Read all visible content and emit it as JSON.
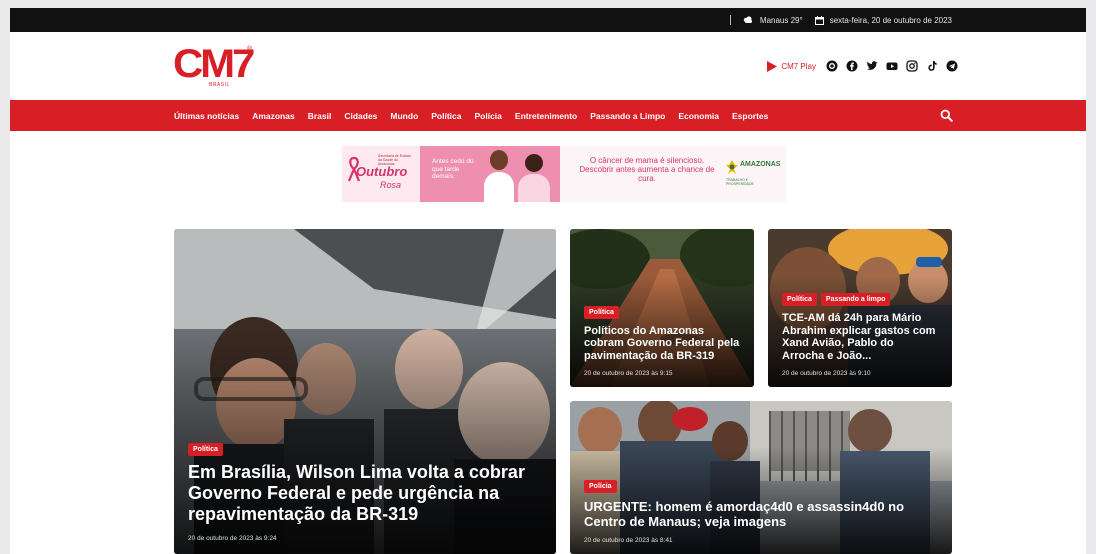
{
  "topbar": {
    "weather": "Manaus 29°",
    "date": "sexta-feira, 20 de outubro de 2023"
  },
  "header": {
    "logo_text": "CM7",
    "logo_reg": "®",
    "logo_sub": "BRASIL",
    "play_label": "CM7 Play",
    "social_icons": [
      "threads-icon",
      "facebook-icon",
      "twitter-icon",
      "youtube-icon",
      "instagram-icon",
      "tiktok-icon",
      "telegram-icon"
    ]
  },
  "nav": {
    "items": [
      "Últimas notícias",
      "Amazonas",
      "Brasil",
      "Cidades",
      "Mundo",
      "Política",
      "Polícia",
      "Entretenimento",
      "Passando a Limpo",
      "Economia",
      "Esportes"
    ]
  },
  "banner": {
    "outubro": "Outubro",
    "rosa": "Rosa",
    "small": "Secretaria de Estado da Saúde do Amazonas",
    "tagline": "Antes cedo do que tarde demais.",
    "message": "O câncer de mama é silencioso. Descobrir antes aumenta a chance de cura.",
    "gov_name": "AMAZONAS",
    "gov_sub": "TRABALHO E PROSPERIDADE"
  },
  "cards": {
    "main": {
      "badges": [
        "Política"
      ],
      "title": "Em Brasília, Wilson Lima volta a cobrar Governo Federal e pede urgência na repavimentação da BR-319",
      "date": "20 de outubro de 2023 às 9:24"
    },
    "road": {
      "badges": [
        "Política"
      ],
      "title": "Políticos do Amazonas cobram Governo Federal pela pavimentação da BR-319",
      "date": "20 de outubro de 2023 às 9:15"
    },
    "tce": {
      "badges": [
        "Política",
        "Passando a limpo"
      ],
      "title": "TCE-AM dá 24h para Mário Abrahim explicar gastos com Xand Avião, Pablo do Arrocha e João...",
      "date": "20 de outubro de 2023 às 9:10"
    },
    "urgent": {
      "badges": [
        "Polícia"
      ],
      "title": "URGENTE: homem é amordaç4d0 e assassin4d0 no Centro de Manaus; veja imagens",
      "date": "20 de outubro de 2023 às 8:41"
    }
  },
  "colors": {
    "brand_red": "#d81f26",
    "topbar_bg": "#111111",
    "pink": "#ee8fb0"
  }
}
